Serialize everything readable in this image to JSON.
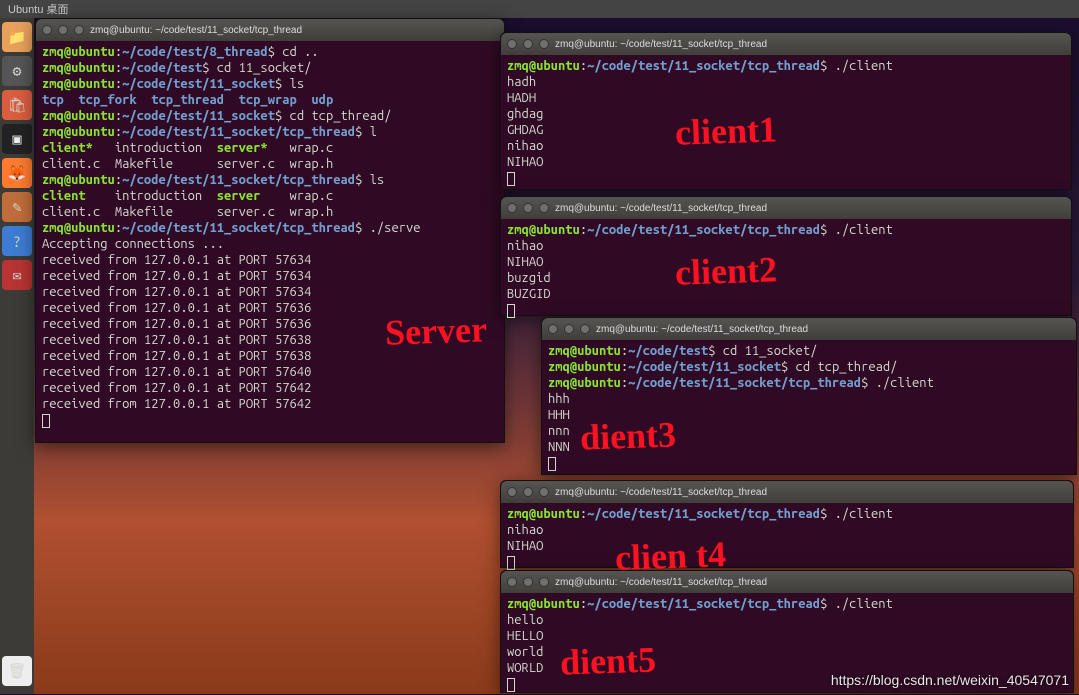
{
  "topbar": {
    "title": "Ubuntu 桌面"
  },
  "launcher": {
    "icons": [
      "folder",
      "settings",
      "software",
      "terminal",
      "firefox",
      "editor",
      "help",
      "mail",
      "trash"
    ]
  },
  "server": {
    "title": "zmq@ubuntu: ~/code/test/11_socket/tcp_thread",
    "ps": {
      "user": "zmq@ubuntu",
      "sep": ":"
    },
    "lines": [
      {
        "path": "~/code/test/8_thread",
        "cmd": "cd .."
      },
      {
        "path": "~/code/test",
        "cmd": "cd 11_socket/"
      },
      {
        "path": "~/code/test/11_socket",
        "cmd": "ls"
      },
      {
        "ls": [
          [
            "tcp",
            "blue"
          ],
          [
            "tcp_fork",
            "blue"
          ],
          [
            "tcp_thread",
            "blue"
          ],
          [
            "tcp_wrap",
            "blue"
          ],
          [
            "udp",
            "blue"
          ]
        ]
      },
      {
        "path": "~/code/test/11_socket",
        "cmd": "cd tcp_thread/"
      },
      {
        "path": "~/code/test/11_socket/tcp_thread",
        "cmd": "l"
      },
      {
        "ls2": [
          [
            "client*",
            "grn"
          ],
          [
            "introduction",
            ""
          ],
          [
            "server*",
            "grn"
          ],
          [
            "wrap.c",
            ""
          ]
        ]
      },
      {
        "ls2": [
          [
            "client.c",
            ""
          ],
          [
            "Makefile",
            ""
          ],
          [
            "server.c",
            ""
          ],
          [
            "wrap.h",
            ""
          ]
        ]
      },
      {
        "path": "~/code/test/11_socket/tcp_thread",
        "cmd": "ls"
      },
      {
        "ls2": [
          [
            "client",
            "grn"
          ],
          [
            "introduction",
            ""
          ],
          [
            "server",
            "grn"
          ],
          [
            "wrap.c",
            ""
          ]
        ]
      },
      {
        "ls2": [
          [
            "client.c",
            ""
          ],
          [
            "Makefile",
            ""
          ],
          [
            "server.c",
            ""
          ],
          [
            "wrap.h",
            ""
          ]
        ]
      },
      {
        "path": "~/code/test/11_socket/tcp_thread",
        "cmd": "./serve"
      },
      {
        "out": "Accepting connections ..."
      },
      {
        "out": "received from 127.0.0.1 at PORT 57634"
      },
      {
        "out": "received from 127.0.0.1 at PORT 57634"
      },
      {
        "out": "received from 127.0.0.1 at PORT 57634"
      },
      {
        "out": "received from 127.0.0.1 at PORT 57636"
      },
      {
        "out": "received from 127.0.0.1 at PORT 57636"
      },
      {
        "out": "received from 127.0.0.1 at PORT 57638"
      },
      {
        "out": "received from 127.0.0.1 at PORT 57638"
      },
      {
        "out": "received from 127.0.0.1 at PORT 57640"
      },
      {
        "out": "received from 127.0.0.1 at PORT 57642"
      },
      {
        "out": "received from 127.0.0.1 at PORT 57642"
      }
    ]
  },
  "c1": {
    "title": "zmq@ubuntu: ~/code/test/11_socket/tcp_thread",
    "prompt": {
      "user": "zmq@ubuntu",
      "path": "~/code/test/11_socket/tcp_thread",
      "cmd": "./client"
    },
    "lines": [
      "hadh",
      "HADH",
      "ghdag",
      "GHDAG",
      "nihao",
      "NIHAO"
    ]
  },
  "c2": {
    "title": "zmq@ubuntu: ~/code/test/11_socket/tcp_thread",
    "prompt": {
      "user": "zmq@ubuntu",
      "path": "~/code/test/11_socket/tcp_thread",
      "cmd": "./client"
    },
    "lines": [
      "nihao",
      "NIHAO",
      "buzgid",
      "BUZGID"
    ]
  },
  "c3": {
    "title": "zmq@ubuntu: ~/code/test/11_socket/tcp_thread",
    "prompts": [
      {
        "user": "zmq@ubuntu",
        "path": "~/code/test",
        "cmd": "cd 11_socket/"
      },
      {
        "user": "zmq@ubuntu",
        "path": "~/code/test/11_socket",
        "cmd": "cd tcp_thread/"
      },
      {
        "user": "zmq@ubuntu",
        "path": "~/code/test/11_socket/tcp_thread",
        "cmd": "./client"
      }
    ],
    "lines": [
      "hhh",
      "HHH",
      "nnn",
      "NNN"
    ]
  },
  "c4": {
    "title": "zmq@ubuntu: ~/code/test/11_socket/tcp_thread",
    "prompt": {
      "user": "zmq@ubuntu",
      "path": "~/code/test/11_socket/tcp_thread",
      "cmd": "./client"
    },
    "lines": [
      "nihao",
      "NIHAO"
    ]
  },
  "c5": {
    "title": "zmq@ubuntu: ~/code/test/11_socket/tcp_thread",
    "prompt": {
      "user": "zmq@ubuntu",
      "path": "~/code/test/11_socket/tcp_thread",
      "cmd": "./client"
    },
    "lines": [
      "hello",
      "HELLO",
      "world",
      "WORLD"
    ]
  },
  "annot": {
    "server": "Server",
    "c1": "client1",
    "c2": "client2",
    "c3": "dient3",
    "c4": "clien t4",
    "c5": "dient5"
  },
  "watermark": "https://blog.csdn.net/weixin_40547071"
}
